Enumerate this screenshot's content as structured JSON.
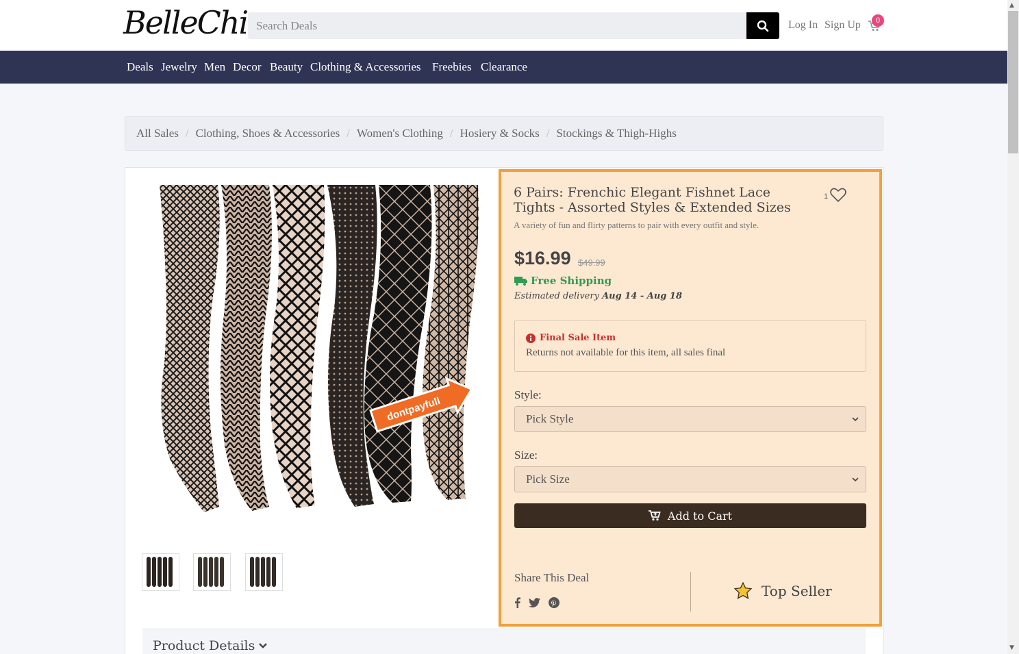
{
  "header": {
    "logo": "BelleChic",
    "search_placeholder": "Search Deals",
    "login": "Log In",
    "signup": "Sign Up",
    "cart_count": "0"
  },
  "nav": [
    "Deals",
    "Jewelry",
    "Men",
    "Decor",
    "Beauty",
    "Clothing & Accessories",
    "Freebies",
    "Clearance"
  ],
  "breadcrumb": [
    "All Sales",
    "Clothing, Shoes & Accessories",
    "Women's Clothing",
    "Hosiery & Socks",
    "Stockings & Thigh-Highs"
  ],
  "product": {
    "title": "6 Pairs: Frenchic Elegant Fishnet Lace Tights - Assorted Styles & Extended Sizes",
    "subtitle": "A variety of fun and flirty patterns to pair with every outfit and style.",
    "favorites": "1",
    "price": "$16.99",
    "old_price": "$49.99",
    "shipping": "Free Shipping",
    "delivery_prefix": "Estimated delivery",
    "delivery_dates": "Aug 14 - Aug 18",
    "final_sale_title": "Final Sale Item",
    "final_sale_text": "Returns not available for this item, all sales final",
    "style_label": "Style:",
    "style_value": "Pick Style",
    "size_label": "Size:",
    "size_value": "Pick Size",
    "add_to_cart": "Add to Cart",
    "share_label": "Share This Deal",
    "top_seller": "Top Seller",
    "details_label": "Product Details",
    "image_badge": "dontpayfull"
  },
  "colors": {
    "nav_bg": "#2f3455",
    "highlight_border": "#f0a03c",
    "highlight_bg": "#fde8d2",
    "shipping_green": "#2e9c52",
    "final_sale_red": "#c9302c",
    "button_dark": "#3b2c21",
    "cart_badge": "#e8467c"
  },
  "icons": [
    "search-icon",
    "cart-icon",
    "heart-icon",
    "truck-icon",
    "info-icon",
    "chevron-down-icon",
    "facebook-icon",
    "twitter-icon",
    "pinterest-icon",
    "star-icon"
  ]
}
